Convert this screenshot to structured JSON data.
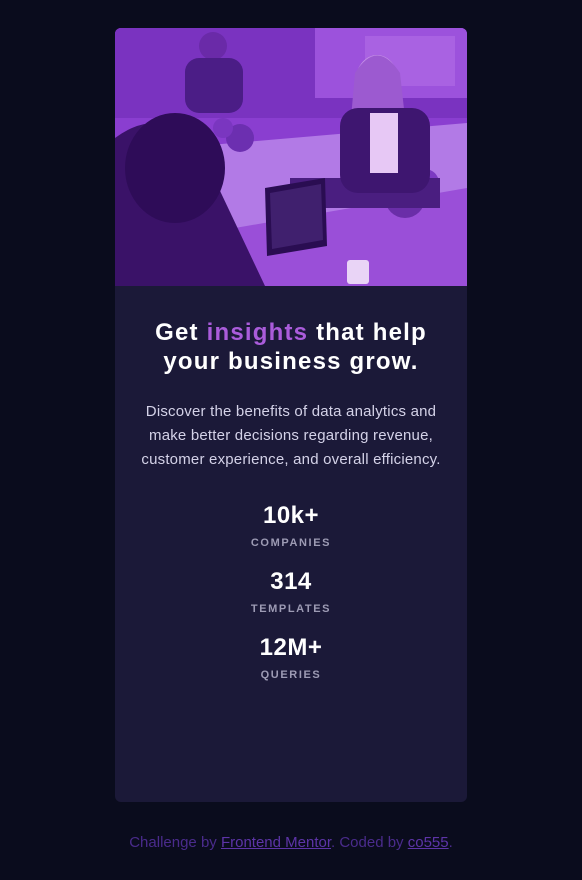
{
  "card": {
    "image_alt": "Women working at desks in an office, purple tinted",
    "headline_before": "Get",
    "headline_accent": "insights",
    "headline_after": "that help your business grow.",
    "description": "Discover the benefits of data analytics and make better decisions regarding revenue, customer experience, and overall efficiency.",
    "stats": [
      {
        "value": "10k+",
        "label": "COMPANIES"
      },
      {
        "value": "314",
        "label": "TEMPLATES"
      },
      {
        "value": "12M+",
        "label": "QUERIES"
      }
    ]
  },
  "attribution": {
    "prefix": "Challenge by",
    "link1": "Frontend Mentor",
    "middle": ". Coded by",
    "link2": "co555",
    "suffix": "."
  },
  "colors": {
    "page_bg": "#0a0c1d",
    "card_bg": "#1b1938",
    "accent": "#aa5cdb",
    "image_tint": "#8e3fd4"
  }
}
